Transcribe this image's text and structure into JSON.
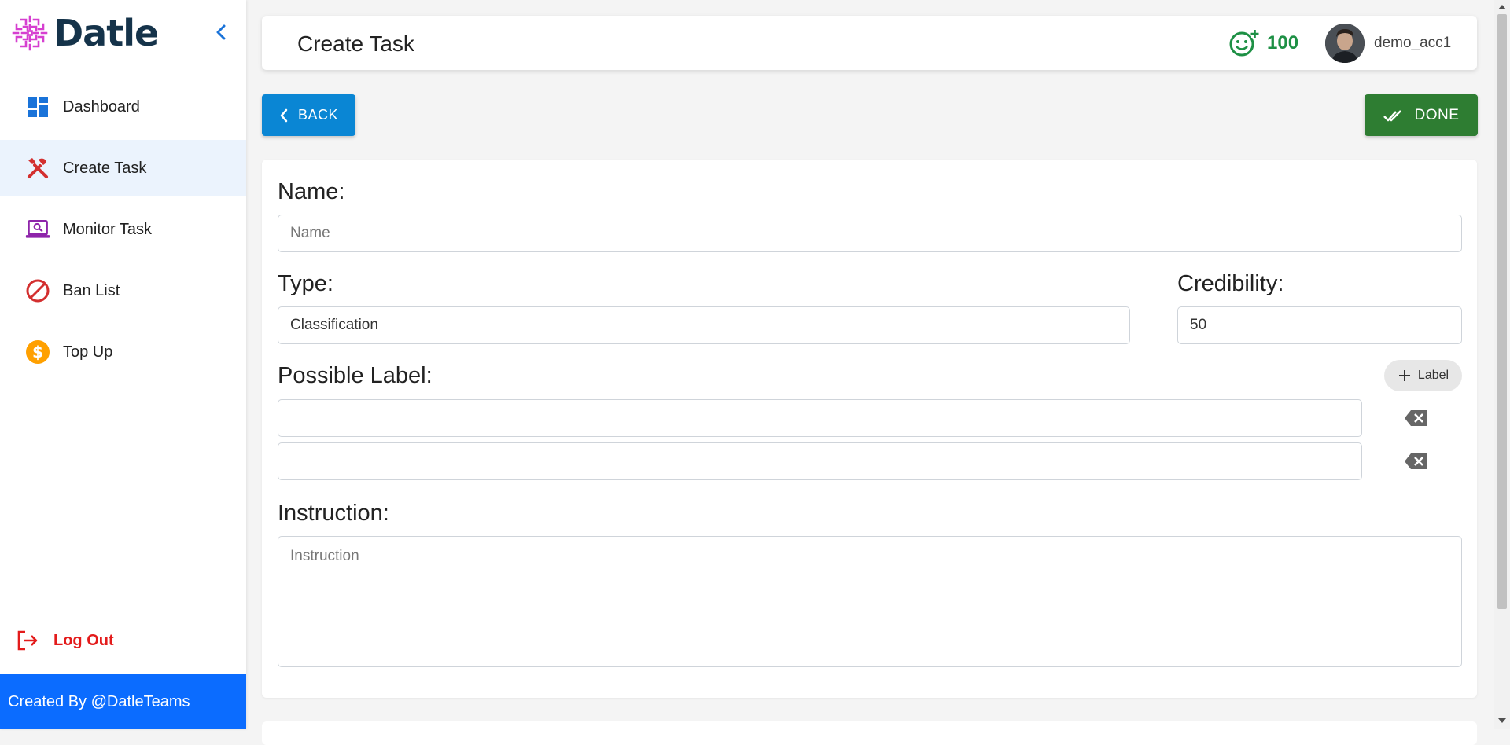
{
  "app": {
    "brand_name": "Datle"
  },
  "sidebar": {
    "items": [
      {
        "label": "Dashboard",
        "icon": "dashboard-icon",
        "active": false
      },
      {
        "label": "Create Task",
        "icon": "tools-icon",
        "active": true
      },
      {
        "label": "Monitor Task",
        "icon": "monitor-icon",
        "active": false
      },
      {
        "label": "Ban List",
        "icon": "ban-icon",
        "active": false
      },
      {
        "label": "Top Up",
        "icon": "dollar-coin-icon",
        "active": false
      }
    ],
    "logout_label": "Log Out",
    "footer_text": "Created By @DatleTeams"
  },
  "header": {
    "title": "Create Task",
    "credits": "100",
    "username": "demo_acc1"
  },
  "actions": {
    "back_label": "BACK",
    "done_label": "DONE"
  },
  "form": {
    "name": {
      "label": "Name:",
      "value": "",
      "placeholder": "Name"
    },
    "type": {
      "label": "Type:",
      "value": "Classification"
    },
    "credibility": {
      "label": "Credibility:",
      "value": "50"
    },
    "possible_label": {
      "label": "Possible Label:",
      "add_button_label": "Label",
      "entries": [
        "",
        ""
      ]
    },
    "instruction": {
      "label": "Instruction:",
      "value": "",
      "placeholder": "Instruction"
    }
  },
  "colors": {
    "brand": "#15334a",
    "logo_accent": "#d63fd0",
    "primary": "#0a86d4",
    "success": "#2e7d32",
    "credit_green": "#1e9045",
    "danger": "#e31b1b",
    "footer_blue": "#0b6cff",
    "active_bg": "#ebf3fd"
  }
}
